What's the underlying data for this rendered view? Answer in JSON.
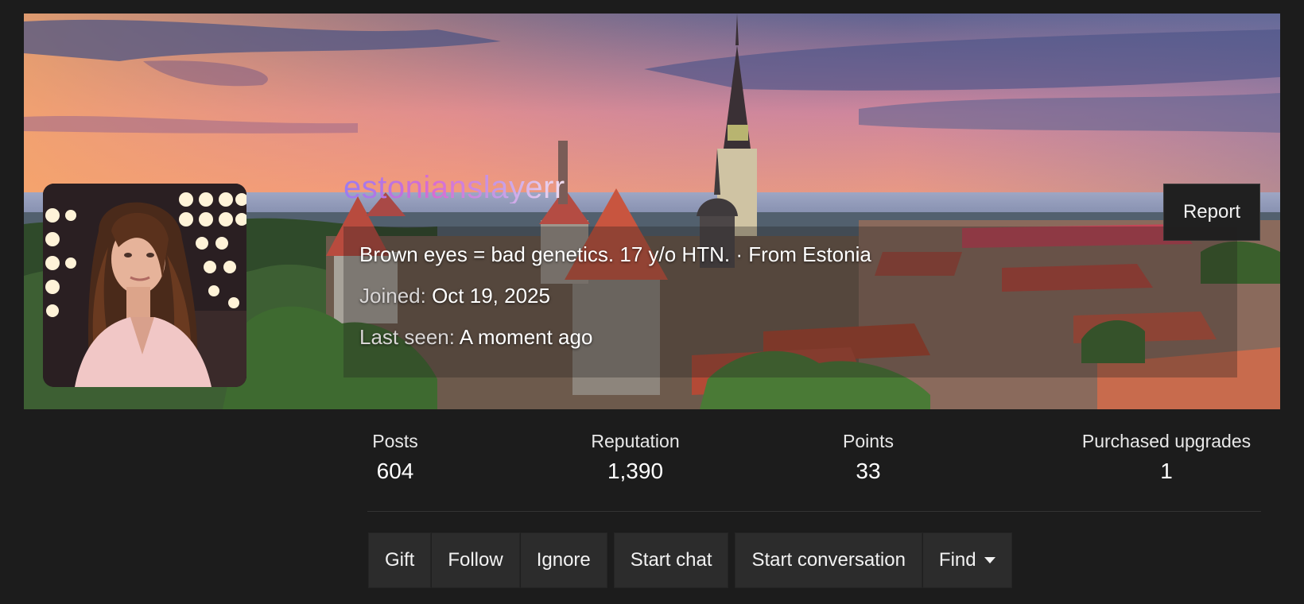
{
  "profile": {
    "username": "estonianslayerr",
    "bio": "Brown eyes = bad genetics. 17 y/o HTN.",
    "separator": "·",
    "location": "From Estonia",
    "joined_label": "Joined:",
    "joined_value": "Oct 19, 2025",
    "last_seen_label": "Last seen:",
    "last_seen_value": "A moment ago"
  },
  "report_label": "Report",
  "stats": [
    {
      "label": "Posts",
      "value": "604"
    },
    {
      "label": "Reputation",
      "value": "1,390"
    },
    {
      "label": "Points",
      "value": "33"
    },
    {
      "label": "Purchased upgrades",
      "value": "1"
    }
  ],
  "actions": {
    "gift": "Gift",
    "follow": "Follow",
    "ignore": "Ignore",
    "start_chat": "Start chat",
    "start_conversation": "Start conversation",
    "find": "Find"
  },
  "icons": {
    "find_dropdown": "chevron-down-icon"
  },
  "colors": {
    "page_bg": "#1c1c1c",
    "button_bg": "#2c2c2c",
    "username_gradient_start": "#9b7cf0",
    "username_gradient_end": "#f3dff0"
  }
}
